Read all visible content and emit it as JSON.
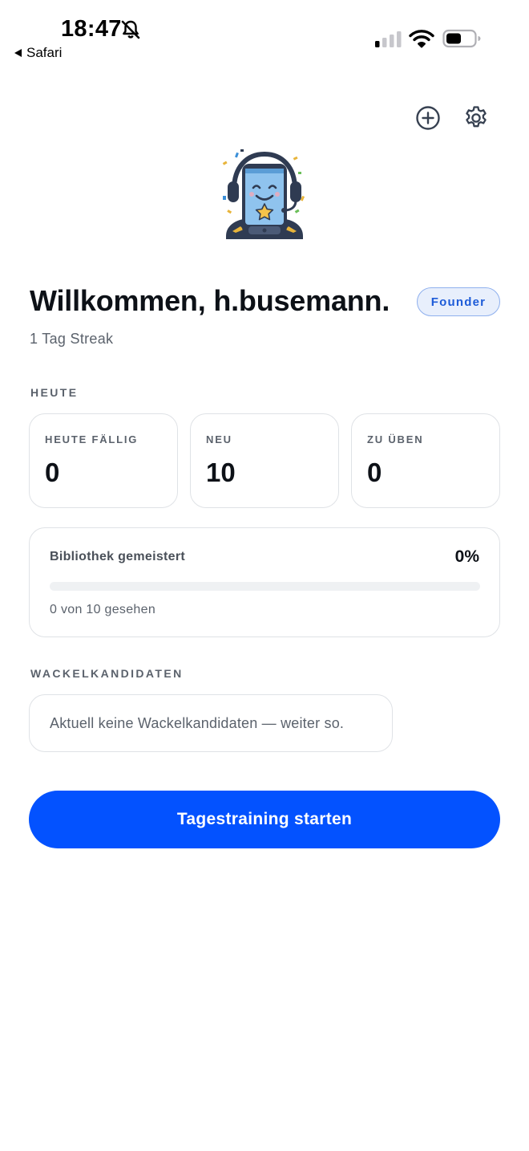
{
  "status_bar": {
    "time": "18:47",
    "back_app": "Safari",
    "icons": [
      "bell-slash-icon",
      "cellular-signal-icon",
      "wifi-icon",
      "battery-icon"
    ]
  },
  "header": {
    "add_icon": "plus-circle-icon",
    "settings_icon": "gear-icon"
  },
  "greeting": {
    "title": "Willkommen, h.busemann.",
    "badge": "Founder",
    "streak": "1 Tag Streak"
  },
  "today": {
    "section_label": "HEUTE",
    "stats": [
      {
        "label": "HEUTE FÄLLIG",
        "value": "0"
      },
      {
        "label": "NEU",
        "value": "10"
      },
      {
        "label": "ZU ÜBEN",
        "value": "0"
      }
    ]
  },
  "library": {
    "title": "Bibliothek gemeistert",
    "percent": "0%",
    "progress": 0,
    "seen": "0 von 10 gesehen"
  },
  "wobble": {
    "section_label": "WACKELKANDIDATEN",
    "empty_text": "Aktuell keine Wackelkandidaten — weiter so."
  },
  "cta": {
    "label": "Tagestraining starten"
  },
  "colors": {
    "accent": "#0352ff",
    "badge_bg": "#e8effc",
    "badge_text": "#1d5bd8",
    "muted_text": "#5b626c",
    "card_border": "#dfe2e6"
  }
}
